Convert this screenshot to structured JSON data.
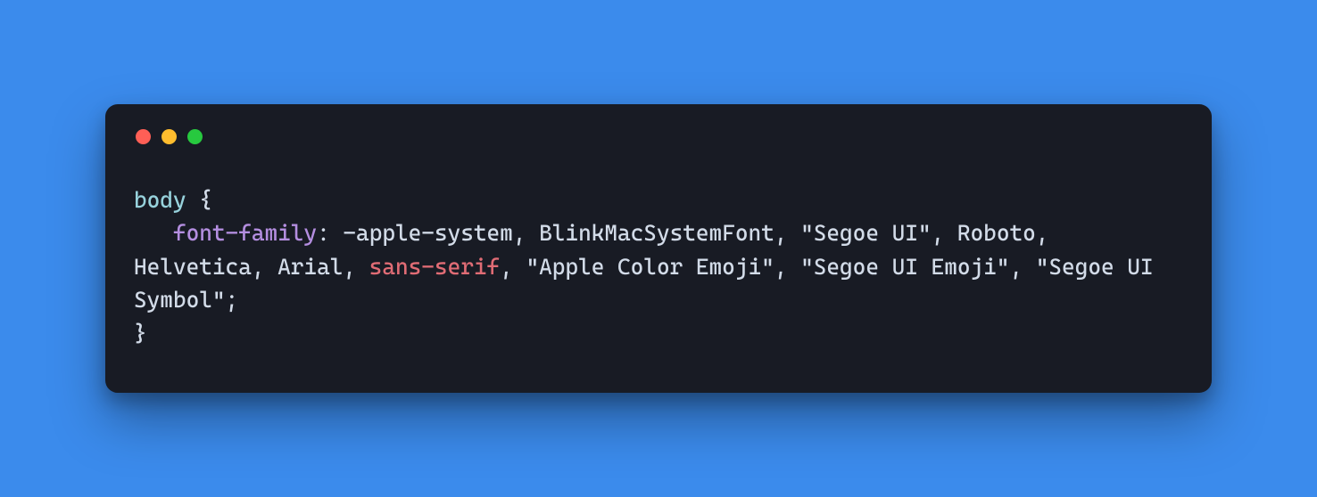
{
  "code": {
    "selector": "body",
    "open_brace": " {",
    "indent": "   ",
    "property": "font-family",
    "colon_space": ": ",
    "val_part1": "-apple-system, BlinkMacSystemFont, \"Segoe UI\", Roboto, Helvetica, Arial, ",
    "val_keyword": "sans-serif",
    "val_part2": ", \"Apple Color Emoji\", \"Segoe UI Emoji\", \"Segoe UI Symbol\";",
    "close_brace": "}"
  }
}
